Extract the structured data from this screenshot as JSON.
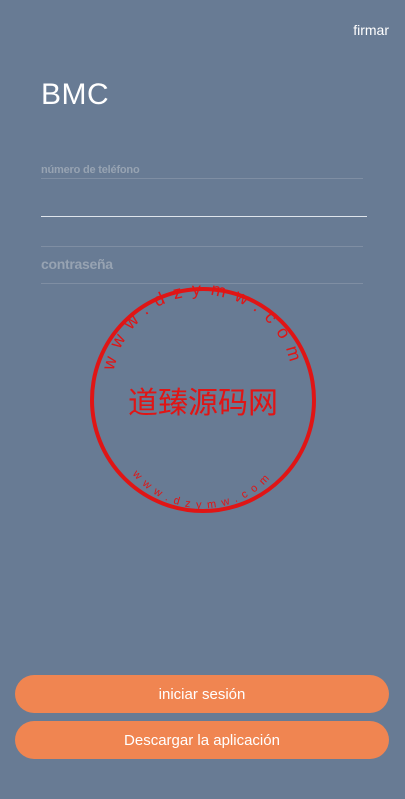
{
  "header": {
    "sign_link": "firmar"
  },
  "brand": "BMC",
  "form": {
    "phone_label": "número de teléfono",
    "password_label": "contraseña"
  },
  "watermark": {
    "main_text": "道臻源码网",
    "outer_text": "www.dzymw.com",
    "inner_text": "www.dzymw.com",
    "color": "#e01515"
  },
  "buttons": {
    "login": "iniciar sesión",
    "download": "Descargar la aplicación"
  },
  "colors": {
    "background": "#687b94",
    "accent": "#f08551"
  }
}
